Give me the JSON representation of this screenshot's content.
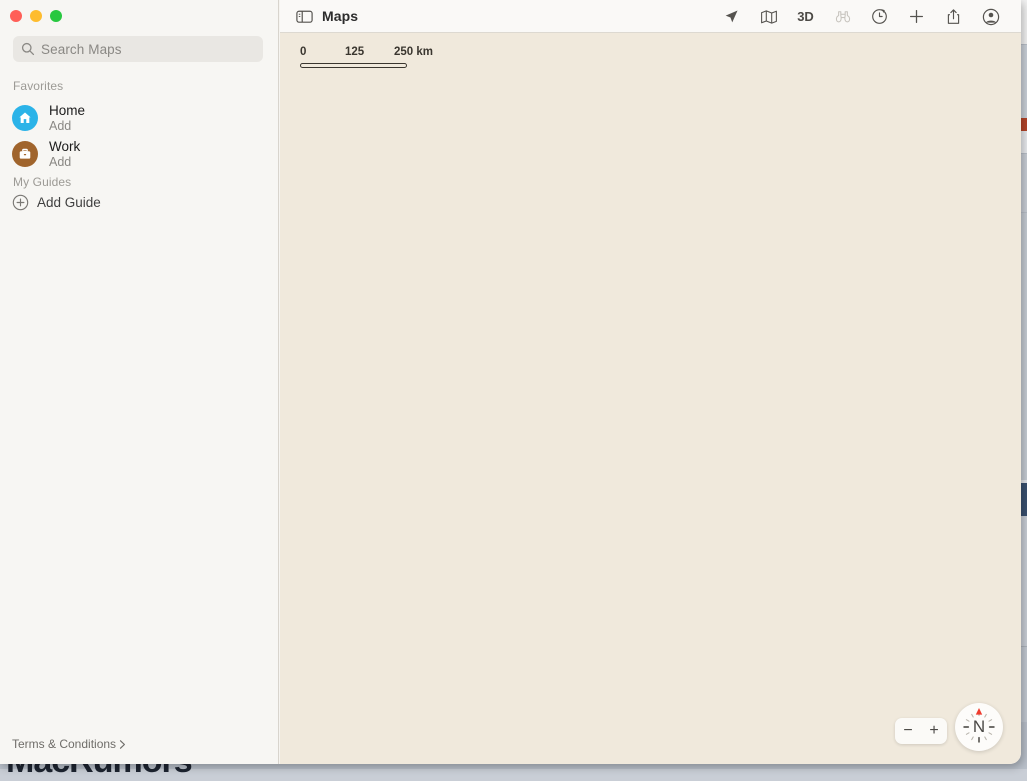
{
  "window": {
    "title": "Maps",
    "traffic_lights": [
      {
        "name": "close",
        "color": "#ff5f57"
      },
      {
        "name": "minimize",
        "color": "#febc2e"
      },
      {
        "name": "zoom",
        "color": "#28c840"
      }
    ]
  },
  "sidebar": {
    "search": {
      "placeholder": "Search Maps",
      "value": "",
      "icon": "search-icon"
    },
    "sections": [
      {
        "header": "Favorites",
        "items": [
          {
            "title": "Home",
            "subtitle": "Add",
            "icon": "house-icon",
            "color": "#2bb3e8"
          },
          {
            "title": "Work",
            "subtitle": "Add",
            "icon": "briefcase-icon",
            "color": "#a0642c"
          }
        ]
      },
      {
        "header": "My Guides",
        "items": [
          {
            "title": "Add Guide",
            "icon": "plus-circle-icon"
          }
        ]
      }
    ],
    "footer": {
      "label": "Terms & Conditions",
      "icon": "chevron-right-icon"
    }
  },
  "toolbar": {
    "sidebar_toggle_icon": "sidebar-icon",
    "title": "Maps",
    "actions": [
      {
        "name": "location",
        "icon": "location-arrow-icon",
        "label": "",
        "disabled": false
      },
      {
        "name": "map-mode",
        "icon": "map-icon",
        "label": "",
        "disabled": false
      },
      {
        "name": "3d-toggle",
        "icon": "text-label",
        "label": "3D",
        "disabled": false
      },
      {
        "name": "look-around",
        "icon": "binoculars-icon",
        "label": "",
        "disabled": true
      },
      {
        "name": "recents",
        "icon": "clock-arrow-icon",
        "label": "",
        "disabled": false
      },
      {
        "name": "new-window",
        "icon": "plus-icon",
        "label": "",
        "disabled": false
      },
      {
        "name": "share",
        "icon": "share-icon",
        "label": "",
        "disabled": false
      },
      {
        "name": "account",
        "icon": "person-circle-icon",
        "label": "",
        "disabled": false
      }
    ]
  },
  "map": {
    "background_color": "#f0e9dc",
    "scale_bar": {
      "start": "0",
      "middle": "125",
      "end": "250 km"
    },
    "zoom_controls": {
      "zoom_out": "−",
      "zoom_in": "+"
    },
    "compass": {
      "cardinal": "N",
      "needle_color": "#ef3b2d"
    }
  },
  "desktop": {
    "watermark": "MacRumors"
  }
}
